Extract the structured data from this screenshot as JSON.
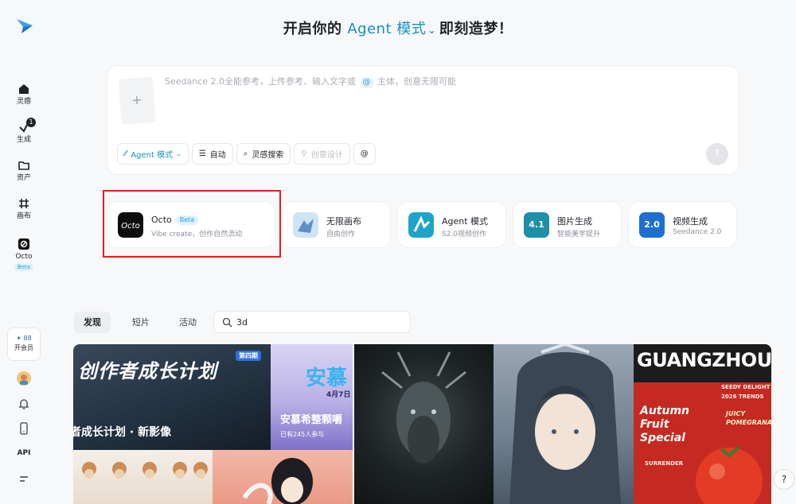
{
  "sidebar": {
    "items": [
      {
        "label": "灵感"
      },
      {
        "label": "生成",
        "badge": "1"
      },
      {
        "label": "资产"
      },
      {
        "label": "画布"
      },
      {
        "label": "Octo",
        "tag": "Beta"
      }
    ],
    "vip": {
      "points": "✦ 88",
      "label": "开会员"
    },
    "api_label": "API"
  },
  "header": {
    "prefix": "开启你的",
    "mode": "Agent 模式",
    "suffix": "即刻造梦！"
  },
  "prompt": {
    "placeholder_a": "Seedance 2.0全能参考，上传参考、输入文字或",
    "at_symbol": "@",
    "placeholder_b": "主体，创意无限可能",
    "upload_symbol": "+",
    "toolbar": {
      "agent": "Agent 模式",
      "auto": "自动",
      "inspire": "灵感搜索",
      "design": "创意设计",
      "mention": "@"
    }
  },
  "cards": [
    {
      "title": "Octo",
      "tag": "Beta",
      "subtitle": "Vibe create，创作自然流动"
    },
    {
      "title": "无限画布",
      "subtitle": "自由创作"
    },
    {
      "title": "Agent 模式",
      "subtitle": "S2.0视频创作"
    },
    {
      "title": "图片生成",
      "subtitle": "智能美学提升",
      "icon_text": "4.1"
    },
    {
      "title": "视频生成",
      "subtitle": "Seedance 2.0",
      "icon_text": "2.0"
    }
  ],
  "tabs": [
    {
      "label": "发现"
    },
    {
      "label": "短片"
    },
    {
      "label": "活动"
    }
  ],
  "search": {
    "value": "3d"
  },
  "gallery": {
    "tile1_text": "创作者成长计划",
    "tile1_tag": "第四期",
    "tile1_caption": "者成长计划 · 新影像",
    "tile2_big": "安慕",
    "tile2_date": "4月7日",
    "tile2_caption": "安慕希整颗嚼",
    "tile2_sub": "已有245人参与",
    "tile5_title": "GUANGZHOU",
    "tile5_left": "SEEDY DELIGHT",
    "tile5_right": "2026 TRENDS",
    "tile5_special": "Autumn Fruit Special",
    "tile5_juicy": "JUICY POMEGRANATE",
    "tile5_surrender": "SURRENDER"
  },
  "colors": {
    "accent": "#1a8fb8",
    "highlight": "#e0201e"
  }
}
